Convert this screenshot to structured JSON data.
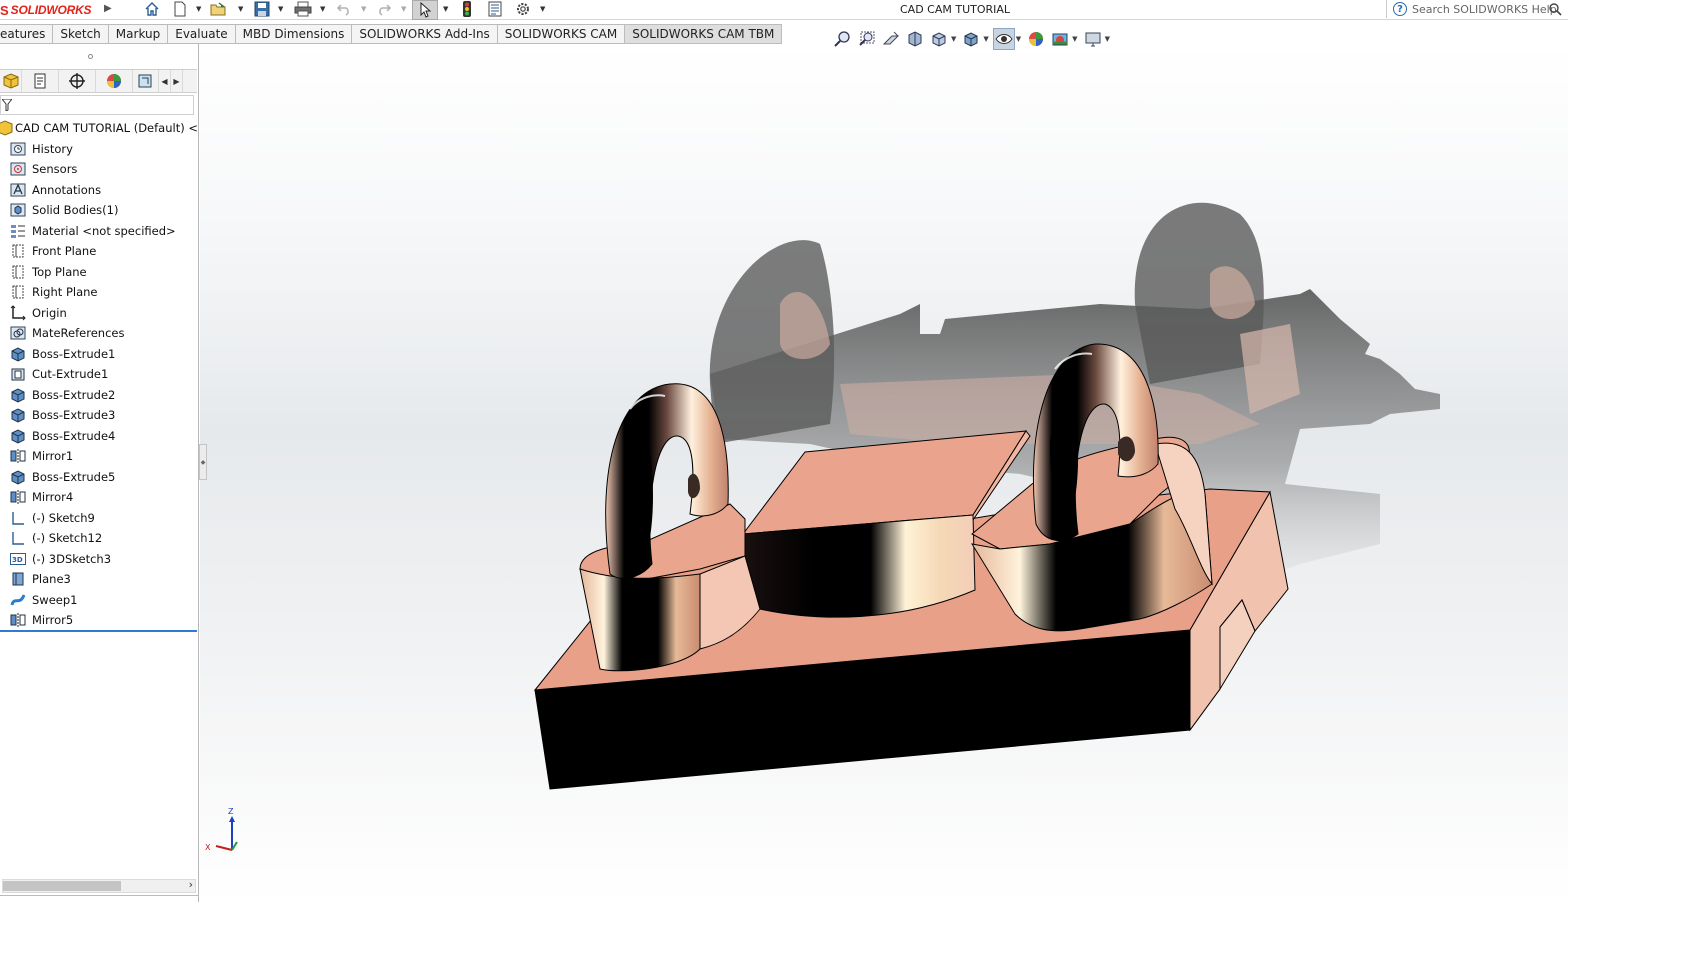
{
  "app": {
    "brand": "SOLIDWORKS",
    "brand_prefix": "S",
    "document_title": "CAD CAM TUTORIAL",
    "help_search_placeholder": "Search SOLIDWORKS Help",
    "accent_color": "#e2231a"
  },
  "quick_access": [
    {
      "name": "home-icon"
    },
    {
      "name": "new-document-icon"
    },
    {
      "name": "open-folder-icon"
    },
    {
      "name": "save-icon"
    },
    {
      "name": "print-icon"
    },
    {
      "name": "undo-icon"
    },
    {
      "name": "redo-icon"
    },
    {
      "name": "select-arrow-icon"
    },
    {
      "name": "rebuild-traffic-light-icon"
    },
    {
      "name": "file-properties-icon"
    },
    {
      "name": "options-gear-icon"
    }
  ],
  "ribbon_tabs": [
    {
      "label": "eatures"
    },
    {
      "label": "Sketch"
    },
    {
      "label": "Markup"
    },
    {
      "label": "Evaluate"
    },
    {
      "label": "MBD Dimensions"
    },
    {
      "label": "SOLIDWORKS Add-Ins"
    },
    {
      "label": "SOLIDWORKS CAM"
    },
    {
      "label": "SOLIDWORKS CAM TBM"
    }
  ],
  "view_toolbar": [
    "zoom-to-fit-icon",
    "zoom-to-area-icon",
    "previous-view-icon",
    "section-view-icon",
    "view-orientation-icon",
    "display-style-icon",
    "hide-show-items-icon",
    "edit-appearance-icon",
    "apply-scene-icon",
    "view-settings-icon"
  ],
  "feature_manager": {
    "tabs": [
      "feature-manager-tab-icon",
      "property-manager-tab-icon",
      "configuration-manager-tab-icon",
      "display-manager-tab-icon",
      "cam-tree-tab-icon"
    ],
    "tree": [
      {
        "label": "CAD CAM TUTORIAL (Default) <<Defa",
        "icon": "part-icon",
        "root": true
      },
      {
        "label": "History",
        "icon": "history-folder-icon"
      },
      {
        "label": "Sensors",
        "icon": "sensors-icon"
      },
      {
        "label": "Annotations",
        "icon": "annotations-icon"
      },
      {
        "label": "Solid Bodies(1)",
        "icon": "solid-bodies-icon"
      },
      {
        "label": "Material <not specified>",
        "icon": "material-icon"
      },
      {
        "label": "Front Plane",
        "icon": "plane-icon"
      },
      {
        "label": "Top Plane",
        "icon": "plane-icon"
      },
      {
        "label": "Right Plane",
        "icon": "plane-icon"
      },
      {
        "label": "Origin",
        "icon": "origin-icon"
      },
      {
        "label": "MateReferences",
        "icon": "mate-references-icon"
      },
      {
        "label": "Boss-Extrude1",
        "icon": "boss-extrude-icon"
      },
      {
        "label": "Cut-Extrude1",
        "icon": "cut-extrude-icon"
      },
      {
        "label": "Boss-Extrude2",
        "icon": "boss-extrude-icon"
      },
      {
        "label": "Boss-Extrude3",
        "icon": "boss-extrude-icon"
      },
      {
        "label": "Boss-Extrude4",
        "icon": "boss-extrude-icon"
      },
      {
        "label": "Mirror1",
        "icon": "mirror-icon"
      },
      {
        "label": "Boss-Extrude5",
        "icon": "boss-extrude-icon"
      },
      {
        "label": "Mirror4",
        "icon": "mirror-icon"
      },
      {
        "label": "(-) Sketch9",
        "icon": "sketch-icon"
      },
      {
        "label": "(-) Sketch12",
        "icon": "sketch-icon"
      },
      {
        "label": "(-) 3DSketch3",
        "icon": "3d-sketch-icon"
      },
      {
        "label": "Plane3",
        "icon": "plane3-icon"
      },
      {
        "label": "Sweep1",
        "icon": "sweep-icon"
      },
      {
        "label": "Mirror5",
        "icon": "mirror-icon"
      }
    ]
  },
  "triad": {
    "z_label": "Z",
    "x_label": "X"
  },
  "material_color": "#e8a089"
}
